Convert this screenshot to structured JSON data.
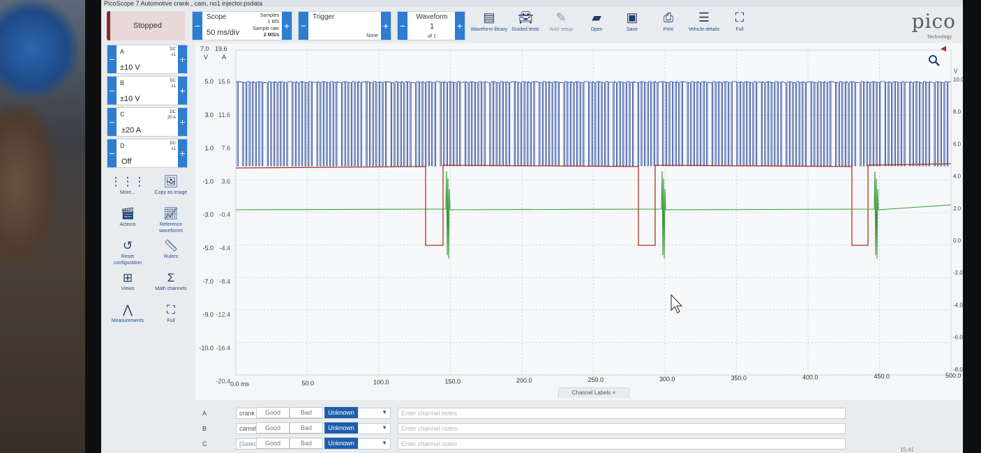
{
  "window": {
    "title": "PicoScope 7 Automotive crank , cam, no1 injector.psdata"
  },
  "toolbar": {
    "run_state": "Stopped",
    "scope": {
      "label": "Scope",
      "timebase": "50 ms/div",
      "samples_label": "Samples",
      "samples_value": "1 MS",
      "rate_label": "Sample rate",
      "rate_value": "2 MS/s"
    },
    "trigger": {
      "label": "Trigger",
      "mode": "None"
    },
    "waveform": {
      "label": "Waveform",
      "index": "1",
      "of": "of 1"
    },
    "tools": [
      "Waveform library",
      "Guided tests",
      "Auto setup",
      "Open",
      "Save",
      "Print",
      "Vehicle details",
      "Full"
    ]
  },
  "logo": {
    "brand": "pico",
    "tagline": "Technology"
  },
  "channels": [
    {
      "name": "A",
      "coupling": "DC",
      "probe": "x1",
      "range": "±10 V"
    },
    {
      "name": "B",
      "coupling": "DC",
      "probe": "x1",
      "range": "±10 V"
    },
    {
      "name": "C",
      "coupling": "DC",
      "probe": "20 A",
      "range": "±20 A"
    },
    {
      "name": "D",
      "coupling": "DC",
      "probe": "x1",
      "range": "Off"
    }
  ],
  "side_tools": [
    "More...",
    "Copy as image",
    "Actions",
    "Reference waveforms",
    "Reset configuration",
    "Rulers",
    "Views",
    "Math channels",
    "Measurements",
    "Full"
  ],
  "colors": {
    "ch_a": "#1f3f9a",
    "ch_b": "#b0321e",
    "ch_c": "#3a9a3a",
    "accent": "#2d7dd2"
  },
  "axes": {
    "left_units": [
      "V",
      "A"
    ],
    "left_top": [
      "7.0",
      "19.6"
    ],
    "left_v": [
      "5.0",
      "3.0",
      "1.0",
      "-1.0",
      "-3.0",
      "-5.0",
      "-7.0",
      "-9.0",
      "-10.0"
    ],
    "left_a": [
      "15.6",
      "11.6",
      "7.6",
      "3.6",
      "-0.4",
      "-4.4",
      "-8.4",
      "-12.4",
      "-16.4",
      "-20.4"
    ],
    "right_unit": "V",
    "right": [
      "10.0",
      "8.0",
      "6.0",
      "4.0",
      "2.0",
      "0.0",
      "-2.0",
      "-4.0",
      "-6.0",
      "-8.0"
    ],
    "x": [
      "0.0 ms",
      "50.0",
      "100.0",
      "150.0",
      "200.0",
      "250.0",
      "300.0",
      "350.0",
      "400.0",
      "450.0",
      "500.0"
    ]
  },
  "channel_labels_tab": "Channel Labels ×",
  "label_rows": [
    {
      "ch": "A",
      "label": "crank",
      "placeholder": "Enter channel notes",
      "options": [
        "Good",
        "Bad",
        "Unknown"
      ],
      "selected": "Unknown"
    },
    {
      "ch": "B",
      "label": "camshaft",
      "placeholder": "Enter channel notes",
      "options": [
        "Good",
        "Bad",
        "Unknown"
      ],
      "selected": "Unknown"
    },
    {
      "ch": "C",
      "label": "[Select label]",
      "placeholder": "Enter channel notes",
      "options": [
        "Good",
        "Bad",
        "Unknown"
      ],
      "selected": "Unknown"
    }
  ],
  "clock": "15:41"
}
